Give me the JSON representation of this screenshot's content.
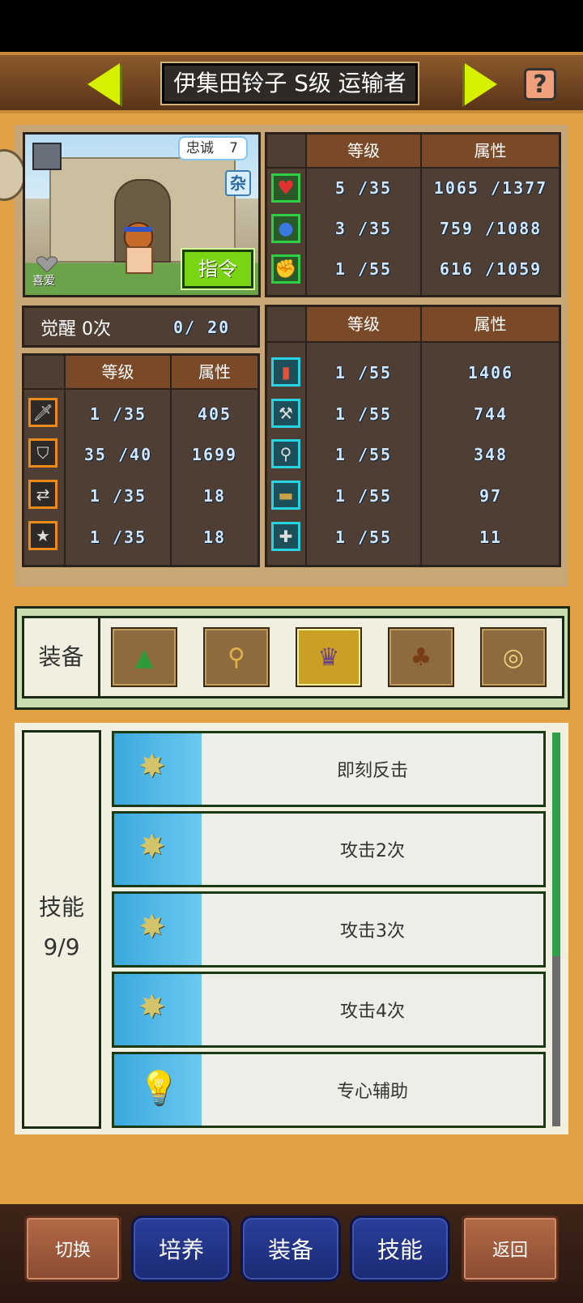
{
  "header": {
    "title": "伊集田铃子 S级 运输者",
    "help_label": "?"
  },
  "portrait": {
    "loyalty_label": "忠诚",
    "loyalty_value": "7",
    "misc_badge": "杂",
    "command_label": "指令",
    "like_label": "喜爱"
  },
  "stats_top": {
    "col_level": "等级",
    "col_attr": "属性",
    "rows": [
      {
        "icon": "heart-icon",
        "level": "5 /35",
        "attr": "1065 /1377"
      },
      {
        "icon": "potion-icon",
        "level": "3 /35",
        "attr": "759 /1088"
      },
      {
        "icon": "muscle-icon",
        "level": "1 /55",
        "attr": "616 /1059"
      }
    ]
  },
  "awakening": {
    "label": "觉醒 0次",
    "value": "0/ 20"
  },
  "stats_left": {
    "col_level": "等级",
    "col_attr": "属性",
    "rows": [
      {
        "icon": "sword-icon",
        "level": "1 /35",
        "attr": "405"
      },
      {
        "icon": "shield-icon",
        "level": "35 /40",
        "attr": "1699"
      },
      {
        "icon": "cross-arrows-icon",
        "level": "1 /35",
        "attr": "18"
      },
      {
        "icon": "star-icon",
        "level": "1 /35",
        "attr": "18"
      }
    ]
  },
  "stats_right": {
    "col_level": "等级",
    "col_attr": "属性",
    "rows": [
      {
        "icon": "book-icon",
        "level": "1 /55",
        "attr": "1406"
      },
      {
        "icon": "hammer-icon",
        "level": "1 /55",
        "attr": "744"
      },
      {
        "icon": "shovel-icon",
        "level": "1 /55",
        "attr": "348"
      },
      {
        "icon": "chest-icon",
        "level": "1 /55",
        "attr": "97"
      },
      {
        "icon": "bandage-icon",
        "level": "1 /55",
        "attr": "11"
      }
    ]
  },
  "equipment": {
    "label": "装备",
    "slots": [
      {
        "icon": "green-hat-icon",
        "glyph": "▲",
        "color": "#2e9a3c"
      },
      {
        "icon": "magic-staff-icon",
        "glyph": "⚲",
        "color": "#d8a54a"
      },
      {
        "icon": "robe-icon",
        "glyph": "♛",
        "color": "#6a3f8c",
        "selected": true
      },
      {
        "icon": "leather-armor-icon",
        "glyph": "♣",
        "color": "#7a3e16"
      },
      {
        "icon": "ring-icon",
        "glyph": "◎",
        "color": "#f2d27a"
      }
    ]
  },
  "skills": {
    "label": "技能",
    "count": "9/9",
    "items": [
      {
        "name": "即刻反击",
        "icon": "sword-burst-icon",
        "glyph": "✸"
      },
      {
        "name": "攻击2次",
        "icon": "sword-burst-icon",
        "glyph": "✸"
      },
      {
        "name": "攻击3次",
        "icon": "sword-burst-icon",
        "glyph": "✸"
      },
      {
        "name": "攻击4次",
        "icon": "sword-burst-icon",
        "glyph": "✸"
      },
      {
        "name": "专心辅助",
        "icon": "lightbulb-icon",
        "glyph": "💡"
      }
    ]
  },
  "nav": {
    "switch": "切换",
    "train": "培养",
    "equip": "装备",
    "skill": "技能",
    "back": "返回"
  }
}
